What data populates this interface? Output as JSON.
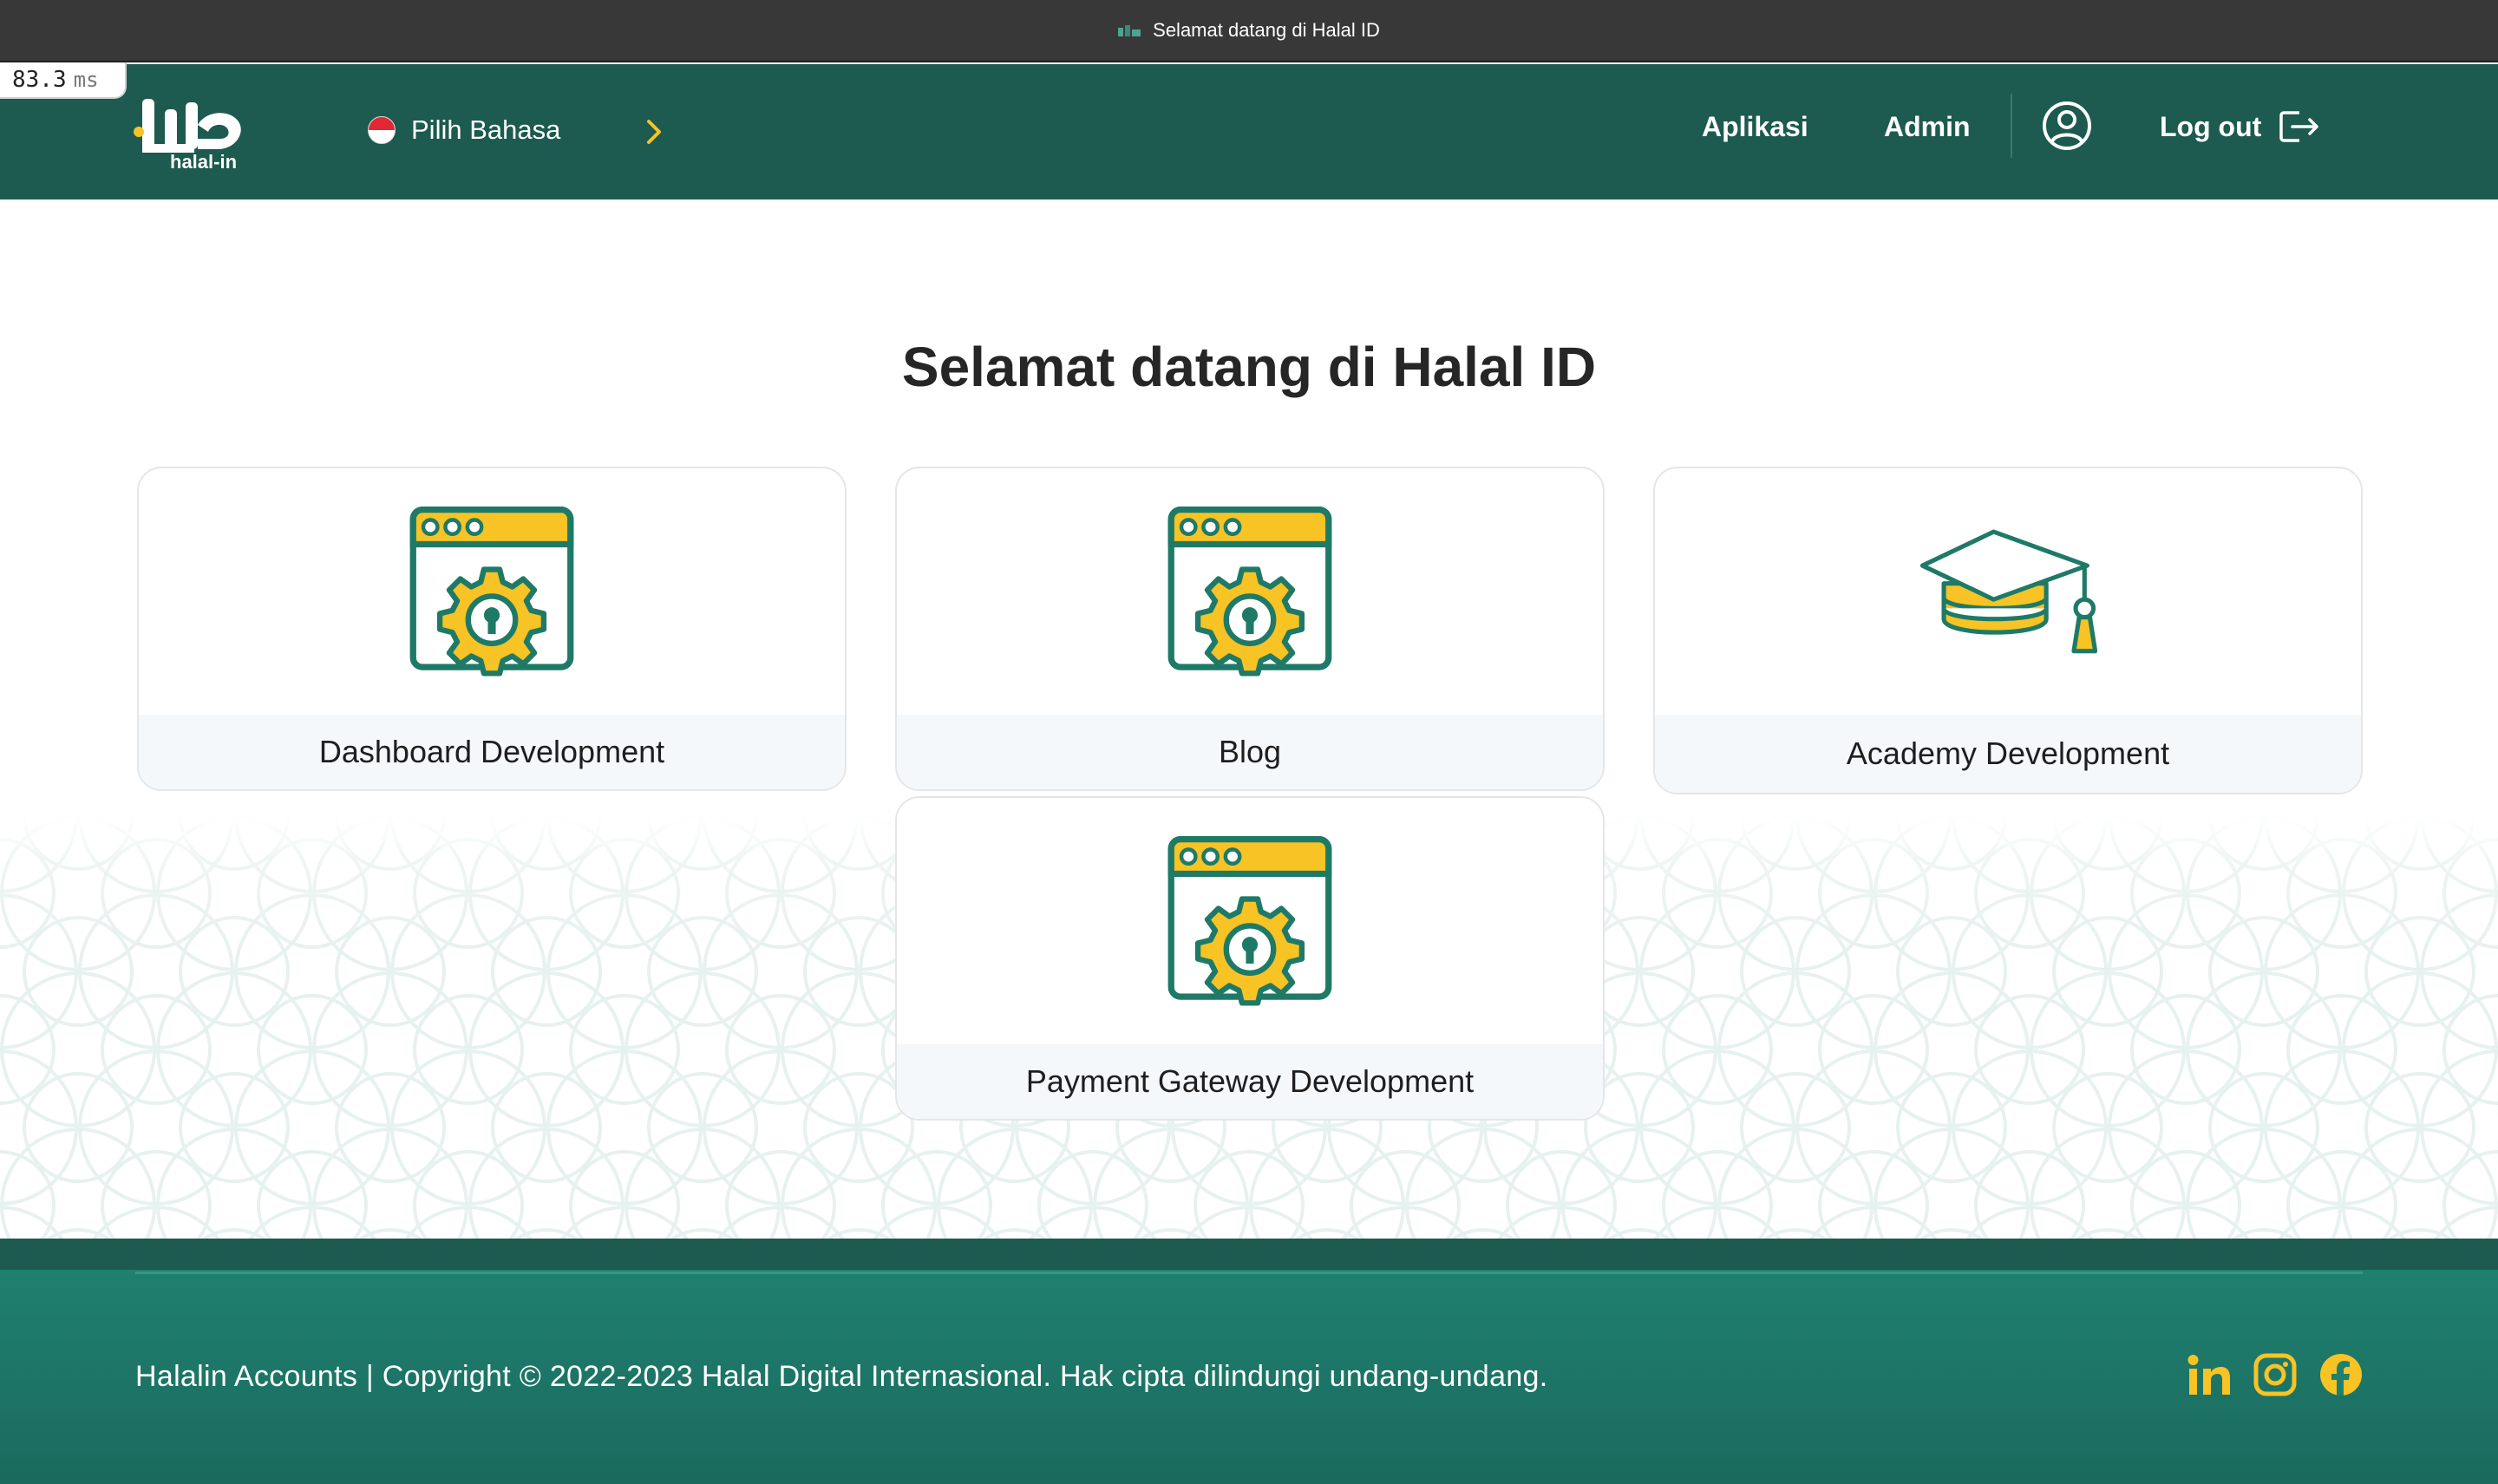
{
  "window": {
    "title": "Selamat datang di Halal ID"
  },
  "perf_overlay": {
    "value": "83.3",
    "unit": "ms"
  },
  "header": {
    "logo_text": "halal-in",
    "language_selector": "Pilih Bahasa",
    "nav": {
      "aplikasi": "Aplikasi",
      "admin": "Admin",
      "logout": "Log out"
    }
  },
  "main": {
    "title": "Selamat datang di Halal ID",
    "cards": [
      {
        "label": "Dashboard Development",
        "icon": "web-settings-icon"
      },
      {
        "label": "Blog",
        "icon": "web-settings-icon"
      },
      {
        "label": "Academy Development",
        "icon": "graduation-cap-icon"
      },
      {
        "label": "Payment Gateway Development",
        "icon": "web-settings-icon"
      }
    ]
  },
  "footer": {
    "text": "Halalin Accounts | Copyright © 2022-2023 Halal Digital Internasional. Hak cipta dilindungi undang-undang.",
    "socials": [
      "linkedin-icon",
      "instagram-icon",
      "facebook-icon"
    ]
  },
  "colors": {
    "header_bg": "#1d5a4f",
    "footer_bg": "#1f8070",
    "accent_yellow": "#f7c325",
    "icon_green": "#1e7a67"
  }
}
